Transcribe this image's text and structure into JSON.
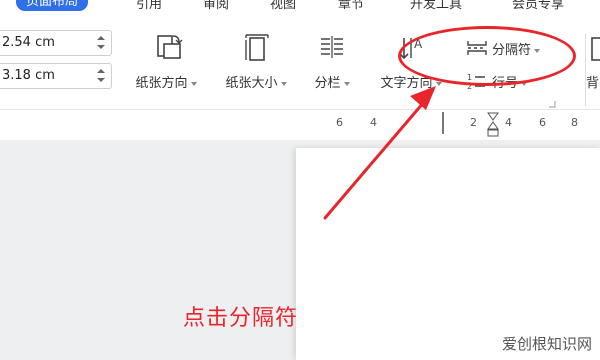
{
  "tabs": [
    "页面布局",
    "引用",
    "审阅",
    "视图",
    "章节",
    "开发工具",
    "会员专享"
  ],
  "margins": {
    "top": "2.54 cm",
    "bottom": "3.18 cm"
  },
  "ribbon": {
    "orientation_label": "纸张方向",
    "size_label": "纸张大小",
    "columns_label": "分栏",
    "text_direction_label": "文字方向",
    "line_number_label": "行号",
    "separator_label": "分隔符",
    "background_label": "背"
  },
  "ruler": {
    "marks": [
      "6",
      "4",
      "2",
      "4",
      "6",
      "8"
    ]
  },
  "annotation": {
    "text": "点击分隔符",
    "color": "#e8252b"
  },
  "watermark": {
    "text": "爱创根知识网"
  },
  "colors": {
    "accent": "#2f6fe8",
    "highlight": "#e8252b"
  }
}
